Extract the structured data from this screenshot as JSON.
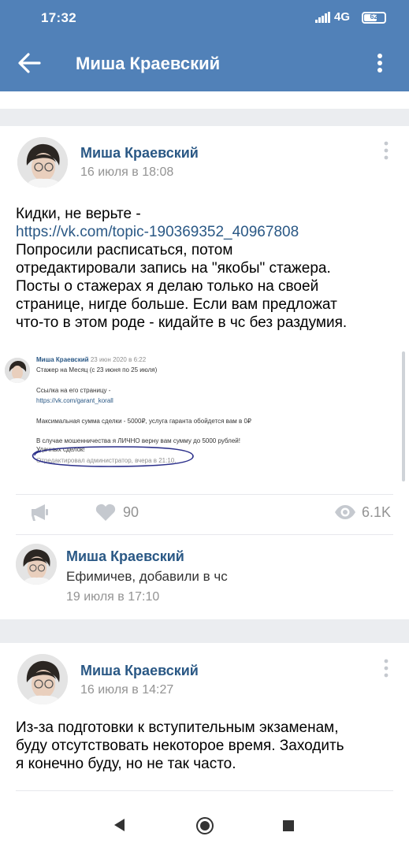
{
  "status_bar": {
    "time": "17:32",
    "network": "4G",
    "battery": "62",
    "battery_level": 0.62
  },
  "app_bar": {
    "title": "Миша Краевский",
    "back_icon": "arrow-left-icon",
    "menu_icon": "more-vertical-icon"
  },
  "posts": [
    {
      "author": "Миша Краевский",
      "date": "16 июля в 18:08",
      "text_lines": [
        "Кидки, не верьте -"
      ],
      "link": "https://vk.com/topic-190369352_40967808",
      "text_after": [
        "Попросили расписаться, потом",
        "отредактировали запись на \"якобы\" стажера.",
        "Посты о стажерах я делаю только на своей",
        "странице, нигде больше. Если вам предложат",
        "что-то в этом роде - кидайте в чс без раздумия."
      ],
      "attachment": {
        "author": "Миша Краевский",
        "date": "23 июн 2020 в 6:22",
        "title": "Стажер на Месяц (с 23 июня по 25 июля)",
        "link_label": "Ссылка на его страницу -",
        "link": "https://vk.com/garant_korall",
        "line_1": "Максимальная сумма сделки - 5000₽, услуга гаранта обойдется вам в 0₽",
        "line_2": "В случае мошенничества я ЛИЧНО верну вам сумму до 5000 рублей!",
        "line_3": "Удачных сделок!",
        "edited": "Отредактировал администратор, вчера в 21:10."
      },
      "likes": "90",
      "views": "6.1K",
      "comment": {
        "author": "Миша Краевский",
        "text": "Ефимичев, добавили в чс",
        "date": "19 июля в 17:10"
      }
    },
    {
      "author": "Миша Краевский",
      "date": "16 июля в 14:27",
      "text_lines": [
        "Из-за подготовки к вступительным экзаменам,",
        "буду отсутствовать некоторое время. Заходить",
        "я конечно буду, но не так часто."
      ]
    }
  ],
  "colors": {
    "header": "#5181b8",
    "link": "#2a5885",
    "muted": "#939393",
    "background": "#ebedf0"
  }
}
